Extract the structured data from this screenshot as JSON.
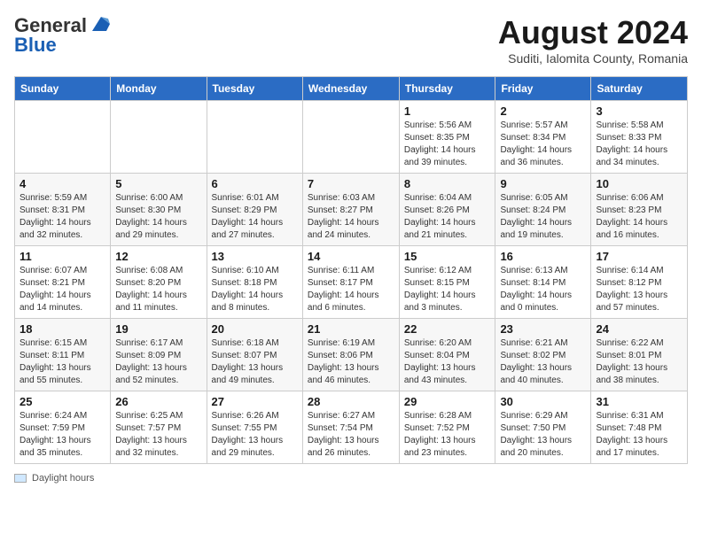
{
  "header": {
    "logo_general": "General",
    "logo_blue": "Blue",
    "month_year": "August 2024",
    "location": "Suditi, Ialomita County, Romania"
  },
  "calendar": {
    "days_of_week": [
      "Sunday",
      "Monday",
      "Tuesday",
      "Wednesday",
      "Thursday",
      "Friday",
      "Saturday"
    ],
    "weeks": [
      [
        {
          "day": "",
          "info": ""
        },
        {
          "day": "",
          "info": ""
        },
        {
          "day": "",
          "info": ""
        },
        {
          "day": "",
          "info": ""
        },
        {
          "day": "1",
          "info": "Sunrise: 5:56 AM\nSunset: 8:35 PM\nDaylight: 14 hours and 39 minutes."
        },
        {
          "day": "2",
          "info": "Sunrise: 5:57 AM\nSunset: 8:34 PM\nDaylight: 14 hours and 36 minutes."
        },
        {
          "day": "3",
          "info": "Sunrise: 5:58 AM\nSunset: 8:33 PM\nDaylight: 14 hours and 34 minutes."
        }
      ],
      [
        {
          "day": "4",
          "info": "Sunrise: 5:59 AM\nSunset: 8:31 PM\nDaylight: 14 hours and 32 minutes."
        },
        {
          "day": "5",
          "info": "Sunrise: 6:00 AM\nSunset: 8:30 PM\nDaylight: 14 hours and 29 minutes."
        },
        {
          "day": "6",
          "info": "Sunrise: 6:01 AM\nSunset: 8:29 PM\nDaylight: 14 hours and 27 minutes."
        },
        {
          "day": "7",
          "info": "Sunrise: 6:03 AM\nSunset: 8:27 PM\nDaylight: 14 hours and 24 minutes."
        },
        {
          "day": "8",
          "info": "Sunrise: 6:04 AM\nSunset: 8:26 PM\nDaylight: 14 hours and 21 minutes."
        },
        {
          "day": "9",
          "info": "Sunrise: 6:05 AM\nSunset: 8:24 PM\nDaylight: 14 hours and 19 minutes."
        },
        {
          "day": "10",
          "info": "Sunrise: 6:06 AM\nSunset: 8:23 PM\nDaylight: 14 hours and 16 minutes."
        }
      ],
      [
        {
          "day": "11",
          "info": "Sunrise: 6:07 AM\nSunset: 8:21 PM\nDaylight: 14 hours and 14 minutes."
        },
        {
          "day": "12",
          "info": "Sunrise: 6:08 AM\nSunset: 8:20 PM\nDaylight: 14 hours and 11 minutes."
        },
        {
          "day": "13",
          "info": "Sunrise: 6:10 AM\nSunset: 8:18 PM\nDaylight: 14 hours and 8 minutes."
        },
        {
          "day": "14",
          "info": "Sunrise: 6:11 AM\nSunset: 8:17 PM\nDaylight: 14 hours and 6 minutes."
        },
        {
          "day": "15",
          "info": "Sunrise: 6:12 AM\nSunset: 8:15 PM\nDaylight: 14 hours and 3 minutes."
        },
        {
          "day": "16",
          "info": "Sunrise: 6:13 AM\nSunset: 8:14 PM\nDaylight: 14 hours and 0 minutes."
        },
        {
          "day": "17",
          "info": "Sunrise: 6:14 AM\nSunset: 8:12 PM\nDaylight: 13 hours and 57 minutes."
        }
      ],
      [
        {
          "day": "18",
          "info": "Sunrise: 6:15 AM\nSunset: 8:11 PM\nDaylight: 13 hours and 55 minutes."
        },
        {
          "day": "19",
          "info": "Sunrise: 6:17 AM\nSunset: 8:09 PM\nDaylight: 13 hours and 52 minutes."
        },
        {
          "day": "20",
          "info": "Sunrise: 6:18 AM\nSunset: 8:07 PM\nDaylight: 13 hours and 49 minutes."
        },
        {
          "day": "21",
          "info": "Sunrise: 6:19 AM\nSunset: 8:06 PM\nDaylight: 13 hours and 46 minutes."
        },
        {
          "day": "22",
          "info": "Sunrise: 6:20 AM\nSunset: 8:04 PM\nDaylight: 13 hours and 43 minutes."
        },
        {
          "day": "23",
          "info": "Sunrise: 6:21 AM\nSunset: 8:02 PM\nDaylight: 13 hours and 40 minutes."
        },
        {
          "day": "24",
          "info": "Sunrise: 6:22 AM\nSunset: 8:01 PM\nDaylight: 13 hours and 38 minutes."
        }
      ],
      [
        {
          "day": "25",
          "info": "Sunrise: 6:24 AM\nSunset: 7:59 PM\nDaylight: 13 hours and 35 minutes."
        },
        {
          "day": "26",
          "info": "Sunrise: 6:25 AM\nSunset: 7:57 PM\nDaylight: 13 hours and 32 minutes."
        },
        {
          "day": "27",
          "info": "Sunrise: 6:26 AM\nSunset: 7:55 PM\nDaylight: 13 hours and 29 minutes."
        },
        {
          "day": "28",
          "info": "Sunrise: 6:27 AM\nSunset: 7:54 PM\nDaylight: 13 hours and 26 minutes."
        },
        {
          "day": "29",
          "info": "Sunrise: 6:28 AM\nSunset: 7:52 PM\nDaylight: 13 hours and 23 minutes."
        },
        {
          "day": "30",
          "info": "Sunrise: 6:29 AM\nSunset: 7:50 PM\nDaylight: 13 hours and 20 minutes."
        },
        {
          "day": "31",
          "info": "Sunrise: 6:31 AM\nSunset: 7:48 PM\nDaylight: 13 hours and 17 minutes."
        }
      ]
    ]
  },
  "footer": {
    "label": "Daylight hours"
  }
}
